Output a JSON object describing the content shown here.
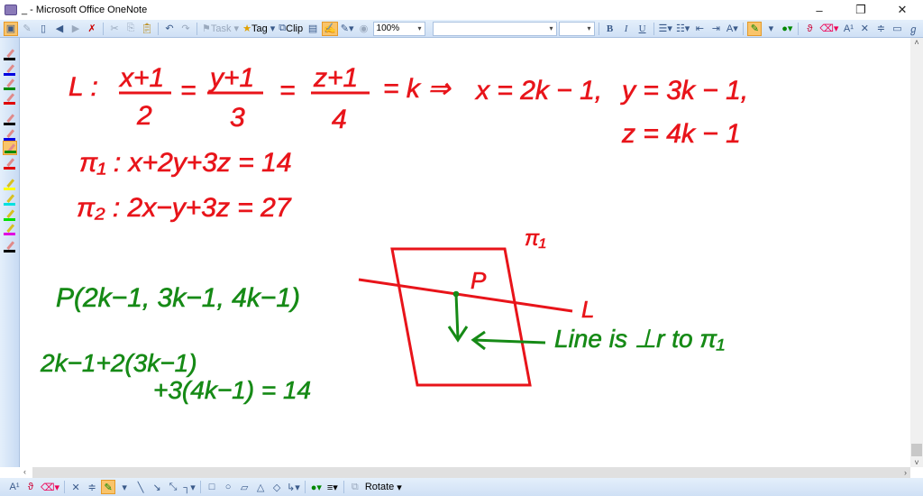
{
  "window": {
    "title": "_ - Microsoft Office OneNote",
    "minimize": "–",
    "restore": "❐",
    "close": "✕"
  },
  "toolbar": {
    "task_label": "Task",
    "tag_label": "Tag",
    "clip_label": "Clip",
    "zoom": "100%",
    "font": "",
    "size": "",
    "bold": "B",
    "italic": "I",
    "underline": "U",
    "font_color": "A",
    "superscript": "A¹"
  },
  "palette": {
    "pens": [
      {
        "color": "#000000"
      },
      {
        "color": "#0000e0"
      },
      {
        "color": "#008a00"
      },
      {
        "color": "#e00000"
      },
      {
        "color": "#000000"
      },
      {
        "color": "#0000e0"
      },
      {
        "color": "#008a00",
        "selected": true
      },
      {
        "color": "#e00000"
      },
      {
        "color": "#ffff00"
      },
      {
        "color": "#00e0e0"
      },
      {
        "color": "#00e000"
      },
      {
        "color": "#e000e0"
      },
      {
        "color": "#000000"
      }
    ]
  },
  "ink": {
    "red": "#e8141a",
    "green": "#168a16",
    "line_label": "L :",
    "frac1_num": "x+1",
    "frac1_den": "2",
    "frac2_num": "y+1",
    "frac2_den": "3",
    "frac3_num": "z+1",
    "frac3_den": "4",
    "eq_k": "= k ⇒",
    "x_eq": "x = 2k − 1,",
    "y_eq": "y = 3k − 1,",
    "z_eq": "z = 4k − 1",
    "plane1": "π₁ : x+2y+3z = 14",
    "plane2": "π₂ : 2x−y+3z = 27",
    "point_p": "P(2k−1, 3k−1, 4k−1)",
    "sub1": "2k−1+2(3k−1)",
    "sub2": "+3(4k−1) = 14",
    "diagram_plane": "π₁",
    "diagram_p": "P",
    "diagram_l": "L",
    "note": "Line is ⊥r to π₁"
  },
  "bottombar": {
    "rotate_label": "Rotate"
  }
}
